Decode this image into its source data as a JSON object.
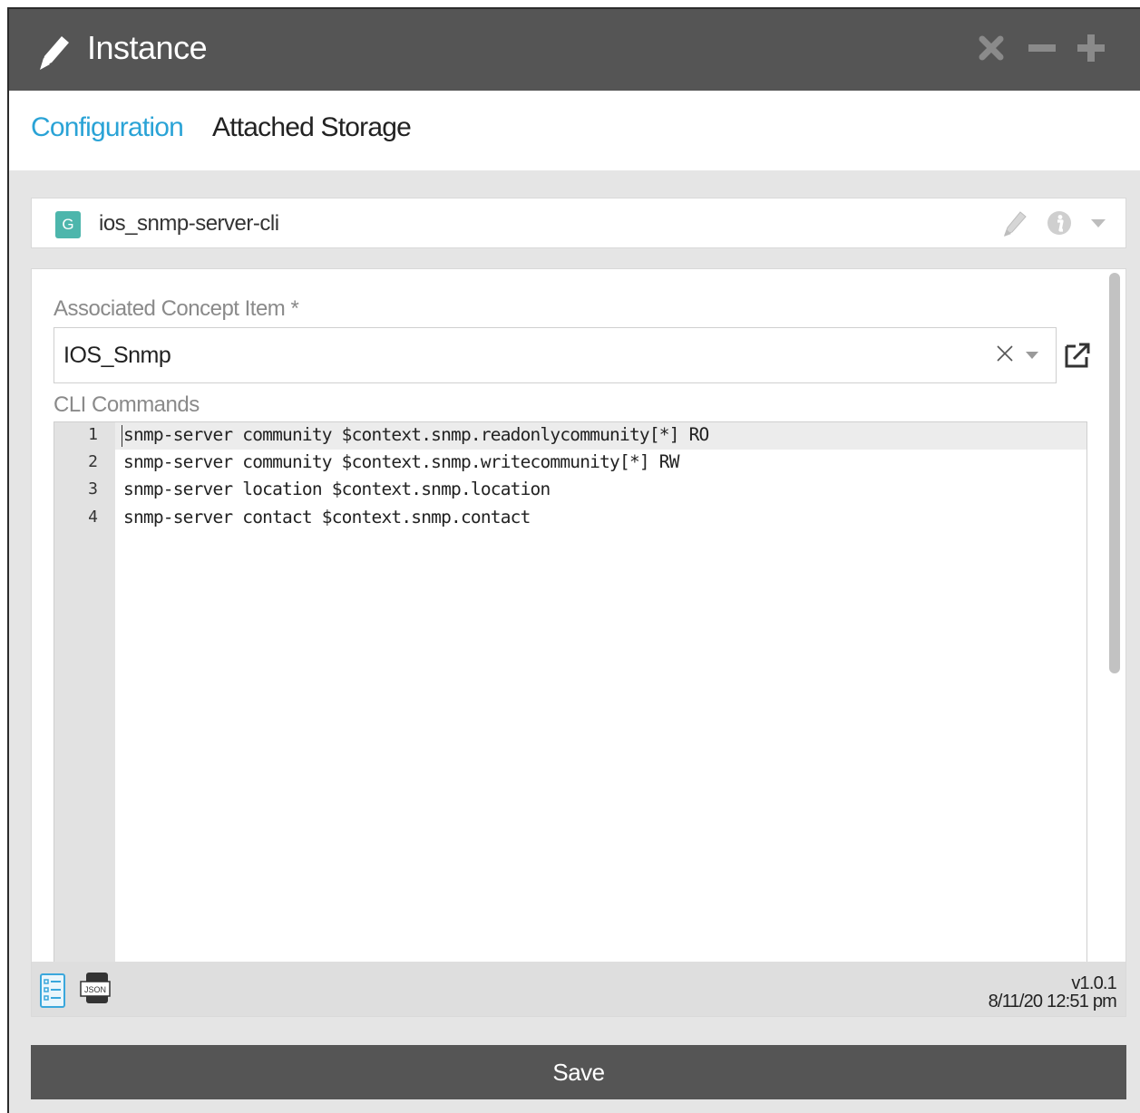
{
  "window": {
    "title": "Instance",
    "title_icon": "pencil-icon",
    "controls": [
      "close-icon",
      "minimize-icon",
      "maximize-icon"
    ],
    "titlebar_color": "#555555"
  },
  "tabs": [
    {
      "label": "Configuration",
      "active": true
    },
    {
      "label": "Attached Storage",
      "active": false
    }
  ],
  "accent_color": "#2aa3d6",
  "template": {
    "badge": "G",
    "badge_color": "#4db6ac",
    "name": "ios_snmp-server-cli"
  },
  "form": {
    "concept_label": "Associated Concept Item *",
    "concept_value": "IOS_Snmp",
    "cli_label": "CLI Commands",
    "code_lines": [
      {
        "num": "1",
        "text": "snmp-server community $context.snmp.readonlycommunity[*] RO"
      },
      {
        "num": "2",
        "text": "snmp-server community $context.snmp.writecommunity[*] RW"
      },
      {
        "num": "3",
        "text": "snmp-server location $context.snmp.location"
      },
      {
        "num": "4",
        "text": "snmp-server contact $context.snmp.contact"
      }
    ]
  },
  "footer": {
    "json_icon_label": "JSON",
    "version": "v1.0.1",
    "timestamp": "8/11/20 12:51 pm"
  },
  "save_label": "Save"
}
